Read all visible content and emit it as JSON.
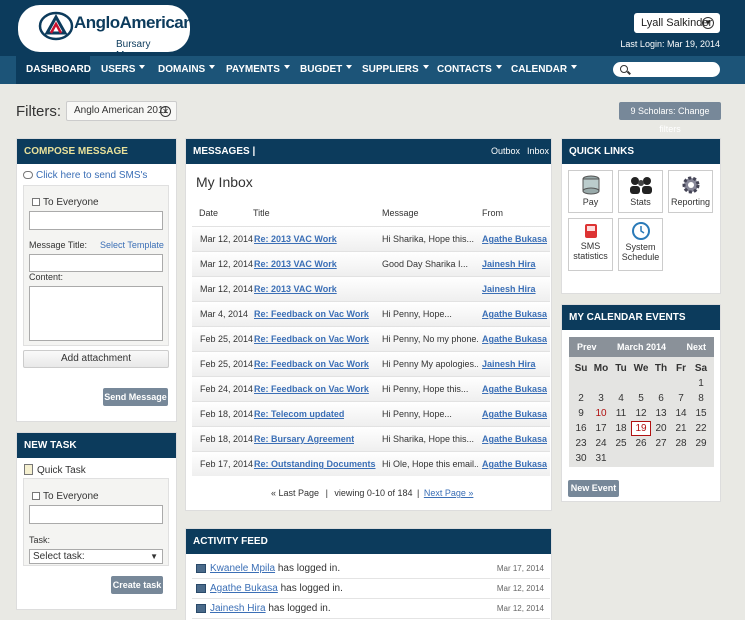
{
  "header": {
    "logo_text": "AngloAmerican",
    "logo_subtitle": "Bursary Manager",
    "user_name": "Lyall Salkinder",
    "last_login": "Last Login: Mar 19, 2014"
  },
  "nav": {
    "items": [
      {
        "label": "DASHBOARD",
        "has_caret": false,
        "active": true
      },
      {
        "label": "USERS",
        "has_caret": true,
        "active": false
      },
      {
        "label": "DOMAINS",
        "has_caret": true,
        "active": false
      },
      {
        "label": "PAYMENTS",
        "has_caret": true,
        "active": false
      },
      {
        "label": "BUGDET",
        "has_caret": true,
        "active": false
      },
      {
        "label": "SUPPLIERS",
        "has_caret": true,
        "active": false
      },
      {
        "label": "CONTACTS",
        "has_caret": true,
        "active": false
      },
      {
        "label": "CALENDAR",
        "has_caret": true,
        "active": false
      }
    ],
    "search_placeholder": ""
  },
  "filters": {
    "label": "Filters:",
    "chip": "Anglo American 2011",
    "change_button": "9 Scholars: Change filters"
  },
  "compose": {
    "title": "COMPOSE MESSAGE",
    "sms_link": "Click here to send SMS's",
    "to_everyone": "To Everyone",
    "message_title_label": "Message Title:",
    "select_template": "Select Template",
    "content_label": "Content:",
    "add_attachment": "Add attachment",
    "send_button": "Send Message"
  },
  "new_task": {
    "title": "NEW TASK",
    "quick_task": "Quick Task",
    "to_everyone": "To Everyone",
    "task_label": "Task:",
    "select_value": "Select task:",
    "create_button": "Create task"
  },
  "messages": {
    "title": "MESSAGES |",
    "outbox": "Outbox",
    "inbox": "Inbox",
    "inbox_heading": "My Inbox",
    "columns": [
      "Date",
      "Title",
      "Message",
      "From"
    ],
    "rows": [
      {
        "date": "Mar 12, 2014",
        "title": "Re: 2013 VAC Work",
        "message": "Hi Sharika, Hope this...",
        "from": "Agathe Bukasa"
      },
      {
        "date": "Mar 12, 2014",
        "title": "Re: 2013 VAC Work",
        "message": "Good Day Sharika I...",
        "from": "Jainesh Hira"
      },
      {
        "date": "Mar 12, 2014",
        "title": "Re: 2013 VAC Work",
        "message": "",
        "from": "Jainesh Hira"
      },
      {
        "date": "Mar 4, 2014",
        "title": "Re: Feedback on Vac Work",
        "message": "Hi Penny,    Hope...",
        "from": "Agathe Bukasa"
      },
      {
        "date": "Feb 25, 2014",
        "title": "Re: Feedback on Vac Work",
        "message": "Hi Penny, No my phone...",
        "from": "Agathe Bukasa"
      },
      {
        "date": "Feb 25, 2014",
        "title": "Re: Feedback on Vac Work",
        "message": "Hi Penny My apologies...",
        "from": "Jainesh Hira"
      },
      {
        "date": "Feb 24, 2014",
        "title": "Re: Feedback on Vac Work",
        "message": "Hi Penny, Hope this...",
        "from": "Agathe Bukasa"
      },
      {
        "date": "Feb 18, 2014",
        "title": "Re: Telecom updated",
        "message": "Hi Penny,    Hope...",
        "from": "Agathe Bukasa"
      },
      {
        "date": "Feb 18, 2014",
        "title": "Re: Bursary Agreement",
        "message": "Hi Sharika, Hope this...",
        "from": "Agathe Bukasa"
      },
      {
        "date": "Feb 17, 2014",
        "title": "Re: Outstanding Documents",
        "message": "Hi Ole, Hope this email...",
        "from": "Agathe Bukasa"
      }
    ],
    "pager_last": "« Last Page",
    "pager_sep": "|",
    "pager_viewing": "viewing 0-10 of 184",
    "pager_next": "Next Page »"
  },
  "activity": {
    "title": "ACTIVITY FEED",
    "rows": [
      {
        "user": "Kwanele Mpila",
        "text": "has logged in.",
        "date": "Mar 17, 2014"
      },
      {
        "user": "Agathe Bukasa",
        "text": "has logged in.",
        "date": "Mar 12, 2014"
      },
      {
        "user": "Jainesh Hira",
        "text": "has logged in.",
        "date": "Mar 12, 2014"
      }
    ]
  },
  "quick_links": {
    "title": "QUICK LINKS",
    "items": [
      {
        "label": "Pay",
        "icon": "database-icon"
      },
      {
        "label": "Stats",
        "icon": "users-icon"
      },
      {
        "label": "Reporting",
        "icon": "gear-icon"
      },
      {
        "label": "SMS statistics",
        "icon": "sms-icon"
      },
      {
        "label": "System Schedule",
        "icon": "clock-icon"
      }
    ]
  },
  "calendar": {
    "title": "MY CALENDAR EVENTS",
    "prev": "Prev",
    "month": "March 2014",
    "next": "Next",
    "weekdays": [
      "Su",
      "Mo",
      "Tu",
      "We",
      "Th",
      "Fr",
      "Sa"
    ],
    "first_weekday_index": 6,
    "days_in_month": 31,
    "highlight_day": 10,
    "today": 19,
    "new_event": "New Event"
  },
  "colors": {
    "header_bg": "#0c3b5c",
    "nav_bg": "#1c5478",
    "link": "#3b6fb6",
    "button_grey": "#778899"
  }
}
